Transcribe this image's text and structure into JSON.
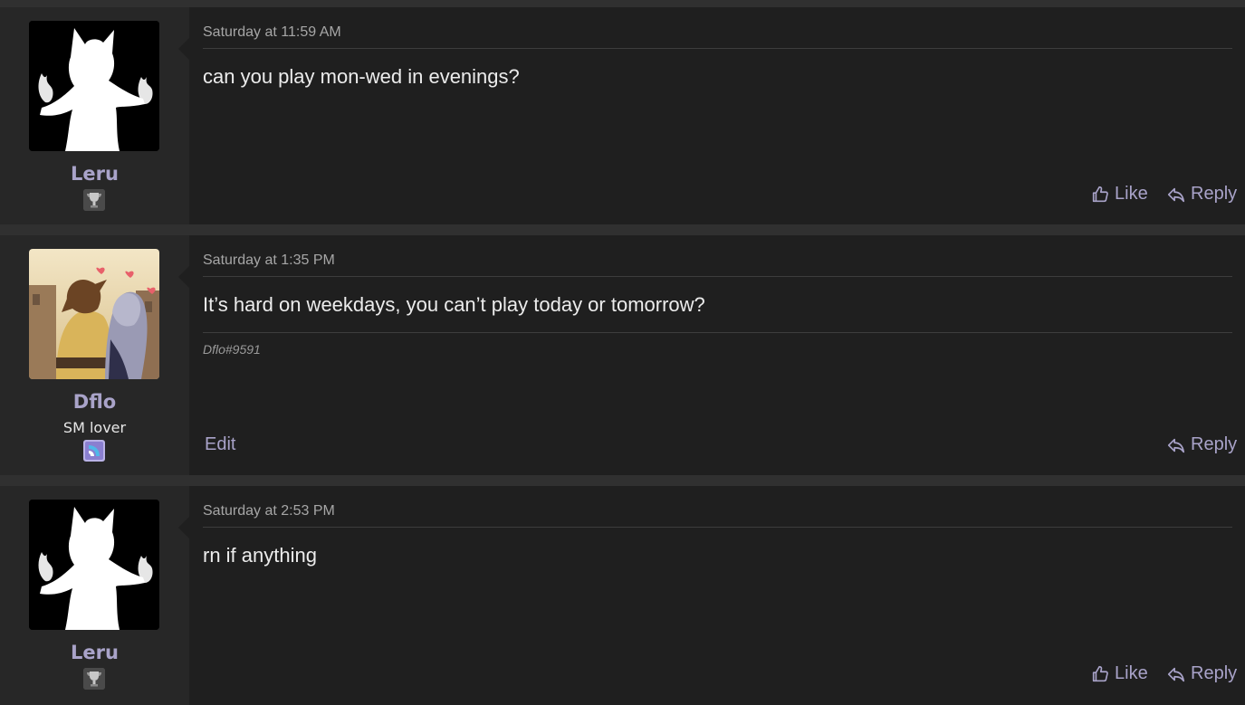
{
  "posts": [
    {
      "username": "Leru",
      "user_title": "",
      "timestamp": "Saturday at 11:59 AM",
      "message": "can you play mon-wed in evenings?",
      "signature": "",
      "like_label": "Like",
      "reply_label": "Reply",
      "avatar_icon": "white-silhouette-with-flames",
      "badge_icon": "trophy-icon"
    },
    {
      "username": "Dflo",
      "user_title": "SM lover",
      "timestamp": "Saturday at 1:35 PM",
      "message": "It’s hard on weekdays, you can’t play today or tomorrow?",
      "signature": "Dflo#9591",
      "edit_label": "Edit",
      "reply_label": "Reply",
      "avatar_icon": "anime-couple-picture",
      "badge_icon": "game-badge-icon"
    },
    {
      "username": "Leru",
      "user_title": "",
      "timestamp": "Saturday at 2:53 PM",
      "message": "rn if anything",
      "signature": "",
      "like_label": "Like",
      "reply_label": "Reply",
      "avatar_icon": "white-silhouette-with-flames",
      "badge_icon": "trophy-icon"
    }
  ],
  "colors": {
    "page_bg": "#303030",
    "post_bg": "#1f1f1f",
    "user_cell_bg": "#272727",
    "accent": "#a9a3c9",
    "text": "#ececec",
    "muted": "#a6a6a6"
  }
}
